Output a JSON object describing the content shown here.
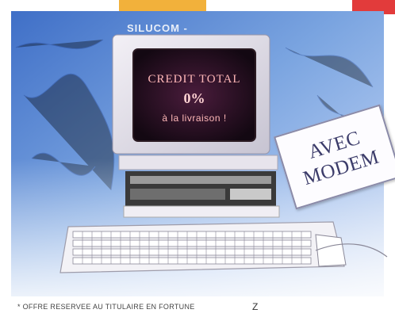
{
  "brand": "SILUCOM -",
  "screen": {
    "line1": "CREDIT TOTAL",
    "line2": "0%",
    "line3": "à la livraison !"
  },
  "stamp": {
    "line1": "AVEC",
    "line2": "MODEM"
  },
  "footer": {
    "caption": "* OFFRE RESERVEE AU TITULAIRE EN FORTUNE",
    "logo": "Z"
  }
}
